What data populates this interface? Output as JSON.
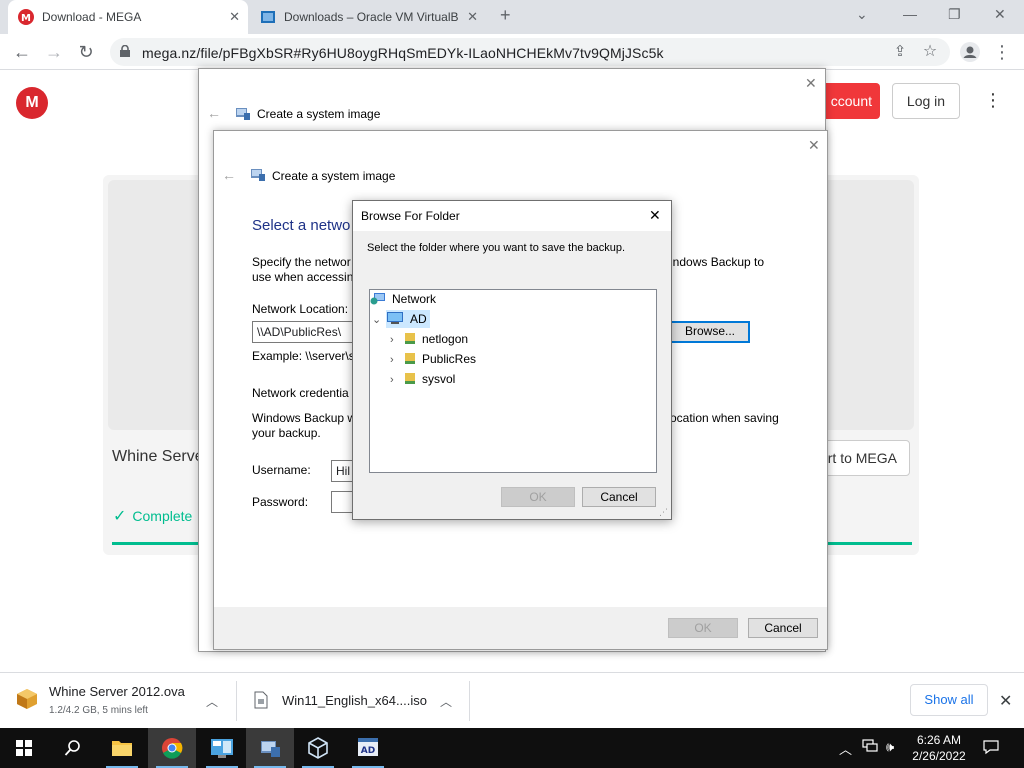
{
  "browser": {
    "tabs": [
      {
        "label": "Download - MEGA"
      },
      {
        "label": "Downloads – Oracle VM VirtualB"
      }
    ],
    "new_tab": "+",
    "url": "mega.nz/file/pFBgXbSR#Ry6HU8oygRHqSmEDYk-ILaoNHCHEkMv7tv9QMjJSc5k"
  },
  "mega": {
    "logo": "M",
    "account_label": "ccount",
    "login_label": "Log in",
    "file_name": "Whine Serve",
    "completed": "Complete",
    "to_mega": "rt to MEGA"
  },
  "backdialog": {
    "title": "Create a system image"
  },
  "sysimage": {
    "title": "Create a system image",
    "heading": "Select a netwo",
    "desc_line1": "Specify the networ",
    "desc_line1_right": "indows Backup to",
    "desc_line2": "use when accessin",
    "network_location_label": "Network Location:",
    "network_location_value": "\\\\AD\\PublicRes\\",
    "browse_label": "Browse...",
    "example": "Example: \\\\server\\s",
    "credentials_heading": "Network credentia",
    "cred_desc_line1": "Windows Backup w",
    "cred_desc_line1_right": "ocation when saving",
    "cred_desc_line2": "your backup.",
    "username_label": "Username:",
    "username_value": "Hil",
    "password_label": "Password:",
    "ok_label": "OK",
    "cancel_label": "Cancel"
  },
  "browse_folder": {
    "title": "Browse For Folder",
    "instruction": "Select the folder where you want to save the backup.",
    "tree": {
      "root": "Network",
      "computer": "AD",
      "folders": [
        "netlogon",
        "PublicRes",
        "sysvol"
      ]
    },
    "ok_label": "OK",
    "cancel_label": "Cancel"
  },
  "downloads": {
    "items": [
      {
        "name": "Whine Server 2012.ova",
        "status": "1.2/4.2 GB, 5 mins left"
      },
      {
        "name": "Win11_English_x64....iso",
        "status": ""
      }
    ],
    "show_all": "Show all"
  },
  "taskbar": {
    "time": "6:26 AM",
    "date": "2/26/2022"
  }
}
